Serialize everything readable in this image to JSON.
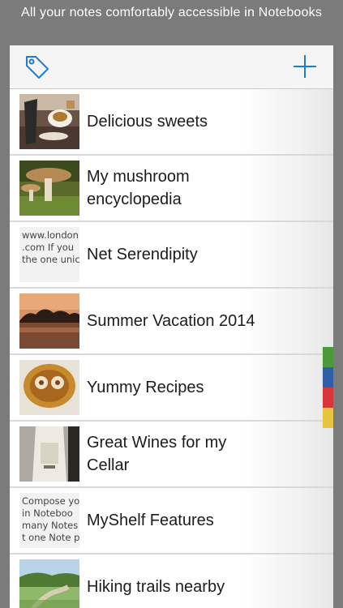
{
  "caption": "All your notes comfortably accessible in Notebooks",
  "notebooks": [
    {
      "title": "Delicious sweets",
      "thumb": "coffee-photo"
    },
    {
      "title": "My mushroom encyclopedia",
      "thumb": "mushroom-photo"
    },
    {
      "title": "Net Serendipity",
      "thumb": "text",
      "thumb_lines": [
        "www.london",
        ".com  If you",
        "the one unic"
      ]
    },
    {
      "title": "Summer Vacation 2014",
      "thumb": "sunset-lake-photo"
    },
    {
      "title": "Yummy Recipes",
      "thumb": "cookie-photo"
    },
    {
      "title": "Great Wines for my Cellar",
      "thumb": "wine-bottle-photo"
    },
    {
      "title": "MyShelf Features",
      "thumb": "text",
      "thumb_lines": [
        "Compose yo",
        "in Noteboo",
        "many Notes",
        "t one Note p"
      ]
    },
    {
      "title": "Hiking trails nearby",
      "thumb": "trail-photo"
    }
  ],
  "color_tabs": [
    "#4a9a3a",
    "#2f5fa8",
    "#d9363a",
    "#e8c340"
  ],
  "accent_color": "#1a7fd4"
}
